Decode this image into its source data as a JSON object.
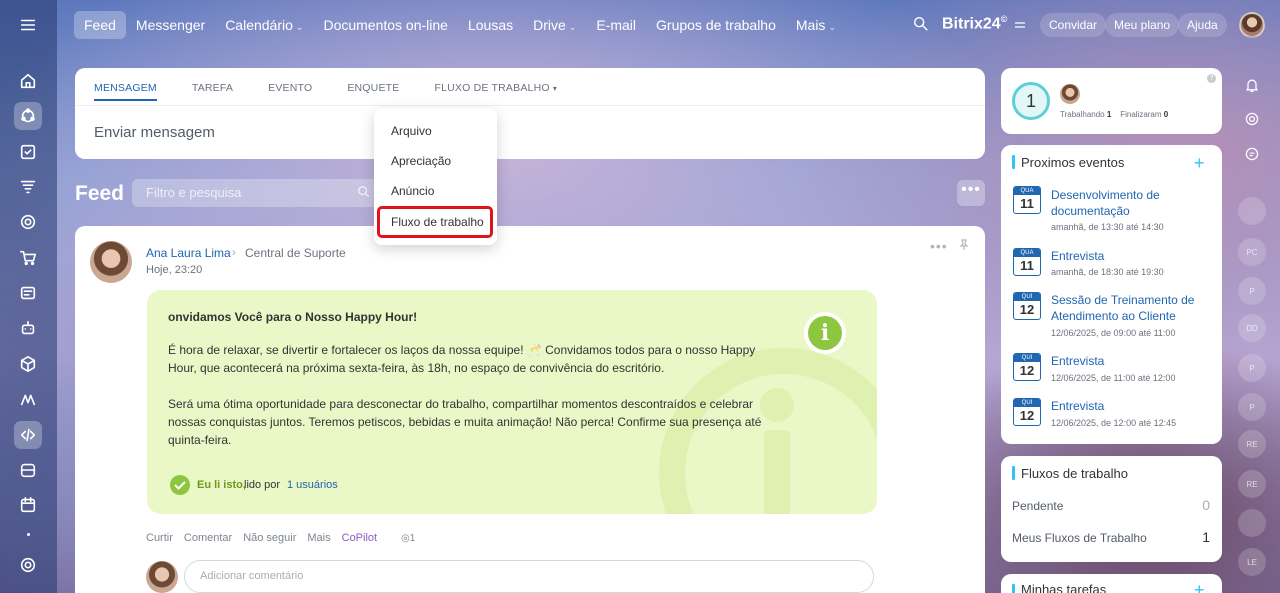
{
  "topnav": {
    "items": [
      {
        "label": "Feed",
        "dropdown": false,
        "active": true
      },
      {
        "label": "Messenger",
        "dropdown": false
      },
      {
        "label": "Calendário",
        "dropdown": true
      },
      {
        "label": "Documentos on-line",
        "dropdown": false
      },
      {
        "label": "Lousas",
        "dropdown": false
      },
      {
        "label": "Drive",
        "dropdown": true
      },
      {
        "label": "E-mail",
        "dropdown": false
      },
      {
        "label": "Grupos de trabalho",
        "dropdown": false
      },
      {
        "label": "Mais",
        "dropdown": true
      }
    ],
    "brand": "Bitrix24",
    "brand_mark": "©",
    "invite": "Convidar",
    "plan": "Meu plano",
    "help": "Ajuda"
  },
  "rail_icons": [
    "home-icon",
    "feed-icon",
    "tasks-icon",
    "filter-icon",
    "crm-icon",
    "shop-icon",
    "sites-icon",
    "robot-icon",
    "box-icon",
    "analytics-icon",
    "code-icon",
    "store-icon",
    "workflow-icon",
    "dot",
    "settings-icon"
  ],
  "composer": {
    "tabs": [
      "MENSAGEM",
      "TAREFA",
      "EVENTO",
      "ENQUETE",
      "FLUXO DE TRABALHO"
    ],
    "input_placeholder": "Enviar mensagem"
  },
  "dropdown": {
    "items": [
      "Arquivo",
      "Apreciação",
      "Anúncio",
      "Fluxo de trabalho"
    ],
    "highlighted": "Fluxo de trabalho"
  },
  "feed": {
    "title": "Feed",
    "filter_placeholder": "Filtro e pesquisa"
  },
  "post": {
    "author": "Ana Laura Lima",
    "destination": "Central de Suporte",
    "time": "Hoje, 23:20",
    "announcement": {
      "title": "onvidamos Você para o Nosso Happy Hour!",
      "p1_line1": "É hora de relaxar, se divertir e fortalecer os laços da nossa equipe! 🥂 Convidamos todos para o nosso Happy",
      "p1_line2": "Hour, que acontecerá na próxima sexta-feira, às 18h, no espaço de convivência do escritório.",
      "p2_line1": "Será uma ótima oportunidade para desconectar do trabalho, compartilhar momentos descontraídos e celebrar",
      "p2_line2": "nossas conquistas juntos. Teremos petiscos, bebidas e muita animação! Não perca! Confirme sua presença até",
      "p2_line3": "quinta-feira.",
      "read_label": "Eu li isto,",
      "read_by": "lido por",
      "read_users": "1 usuários"
    },
    "actions": [
      "Curtir",
      "Comentar",
      "Não seguir",
      "Mais",
      "CoPilot"
    ],
    "views": "1",
    "comment_placeholder": "Adicionar comentário"
  },
  "timer": {
    "count": "1",
    "working_label": "Trabalhando",
    "working_count": "1",
    "finished_label": "Finalizaram",
    "finished_count": "0"
  },
  "events": {
    "title": "Proximos eventos",
    "items": [
      {
        "day": "QUA",
        "num": "11",
        "title1": "Desenvolvimento de",
        "title2": "documentação",
        "sub": "amanhã, de 13:30 até 14:30"
      },
      {
        "day": "QUA",
        "num": "11",
        "title1": "Entrevista",
        "title2": "",
        "sub": "amanhã, de 18:30 até 19:30"
      },
      {
        "day": "QUI",
        "num": "12",
        "title1": "Sessão de Treinamento de",
        "title2": "Atendimento ao Cliente",
        "sub": "12/06/2025, de 09:00 até 11:00"
      },
      {
        "day": "QUI",
        "num": "12",
        "title1": "Entrevista",
        "title2": "",
        "sub": "12/06/2025, de 11:00 até 12:00"
      },
      {
        "day": "QUI",
        "num": "12",
        "title1": "Entrevista",
        "title2": "",
        "sub": "12/06/2025, de 12:00 até 12:45"
      }
    ]
  },
  "workflows": {
    "title": "Fluxos de trabalho",
    "pending_label": "Pendente",
    "pending_value": "0",
    "mine_label": "Meus Fluxos de Trabalho",
    "mine_value": "1"
  },
  "tasks": {
    "title": "Minhas tarefas"
  },
  "right_strip": [
    "bell-icon",
    "spiral-icon",
    "chat-icon",
    "",
    "avatar",
    "PC",
    "P",
    "DD",
    "P",
    "P",
    "RE",
    "RE",
    "avatar",
    "LE"
  ],
  "colors": {
    "accent": "#2066b0",
    "highlight": "#e0131b",
    "announcement_bg": "#eaf7c6",
    "announcement_icon": "#8dc63f"
  }
}
